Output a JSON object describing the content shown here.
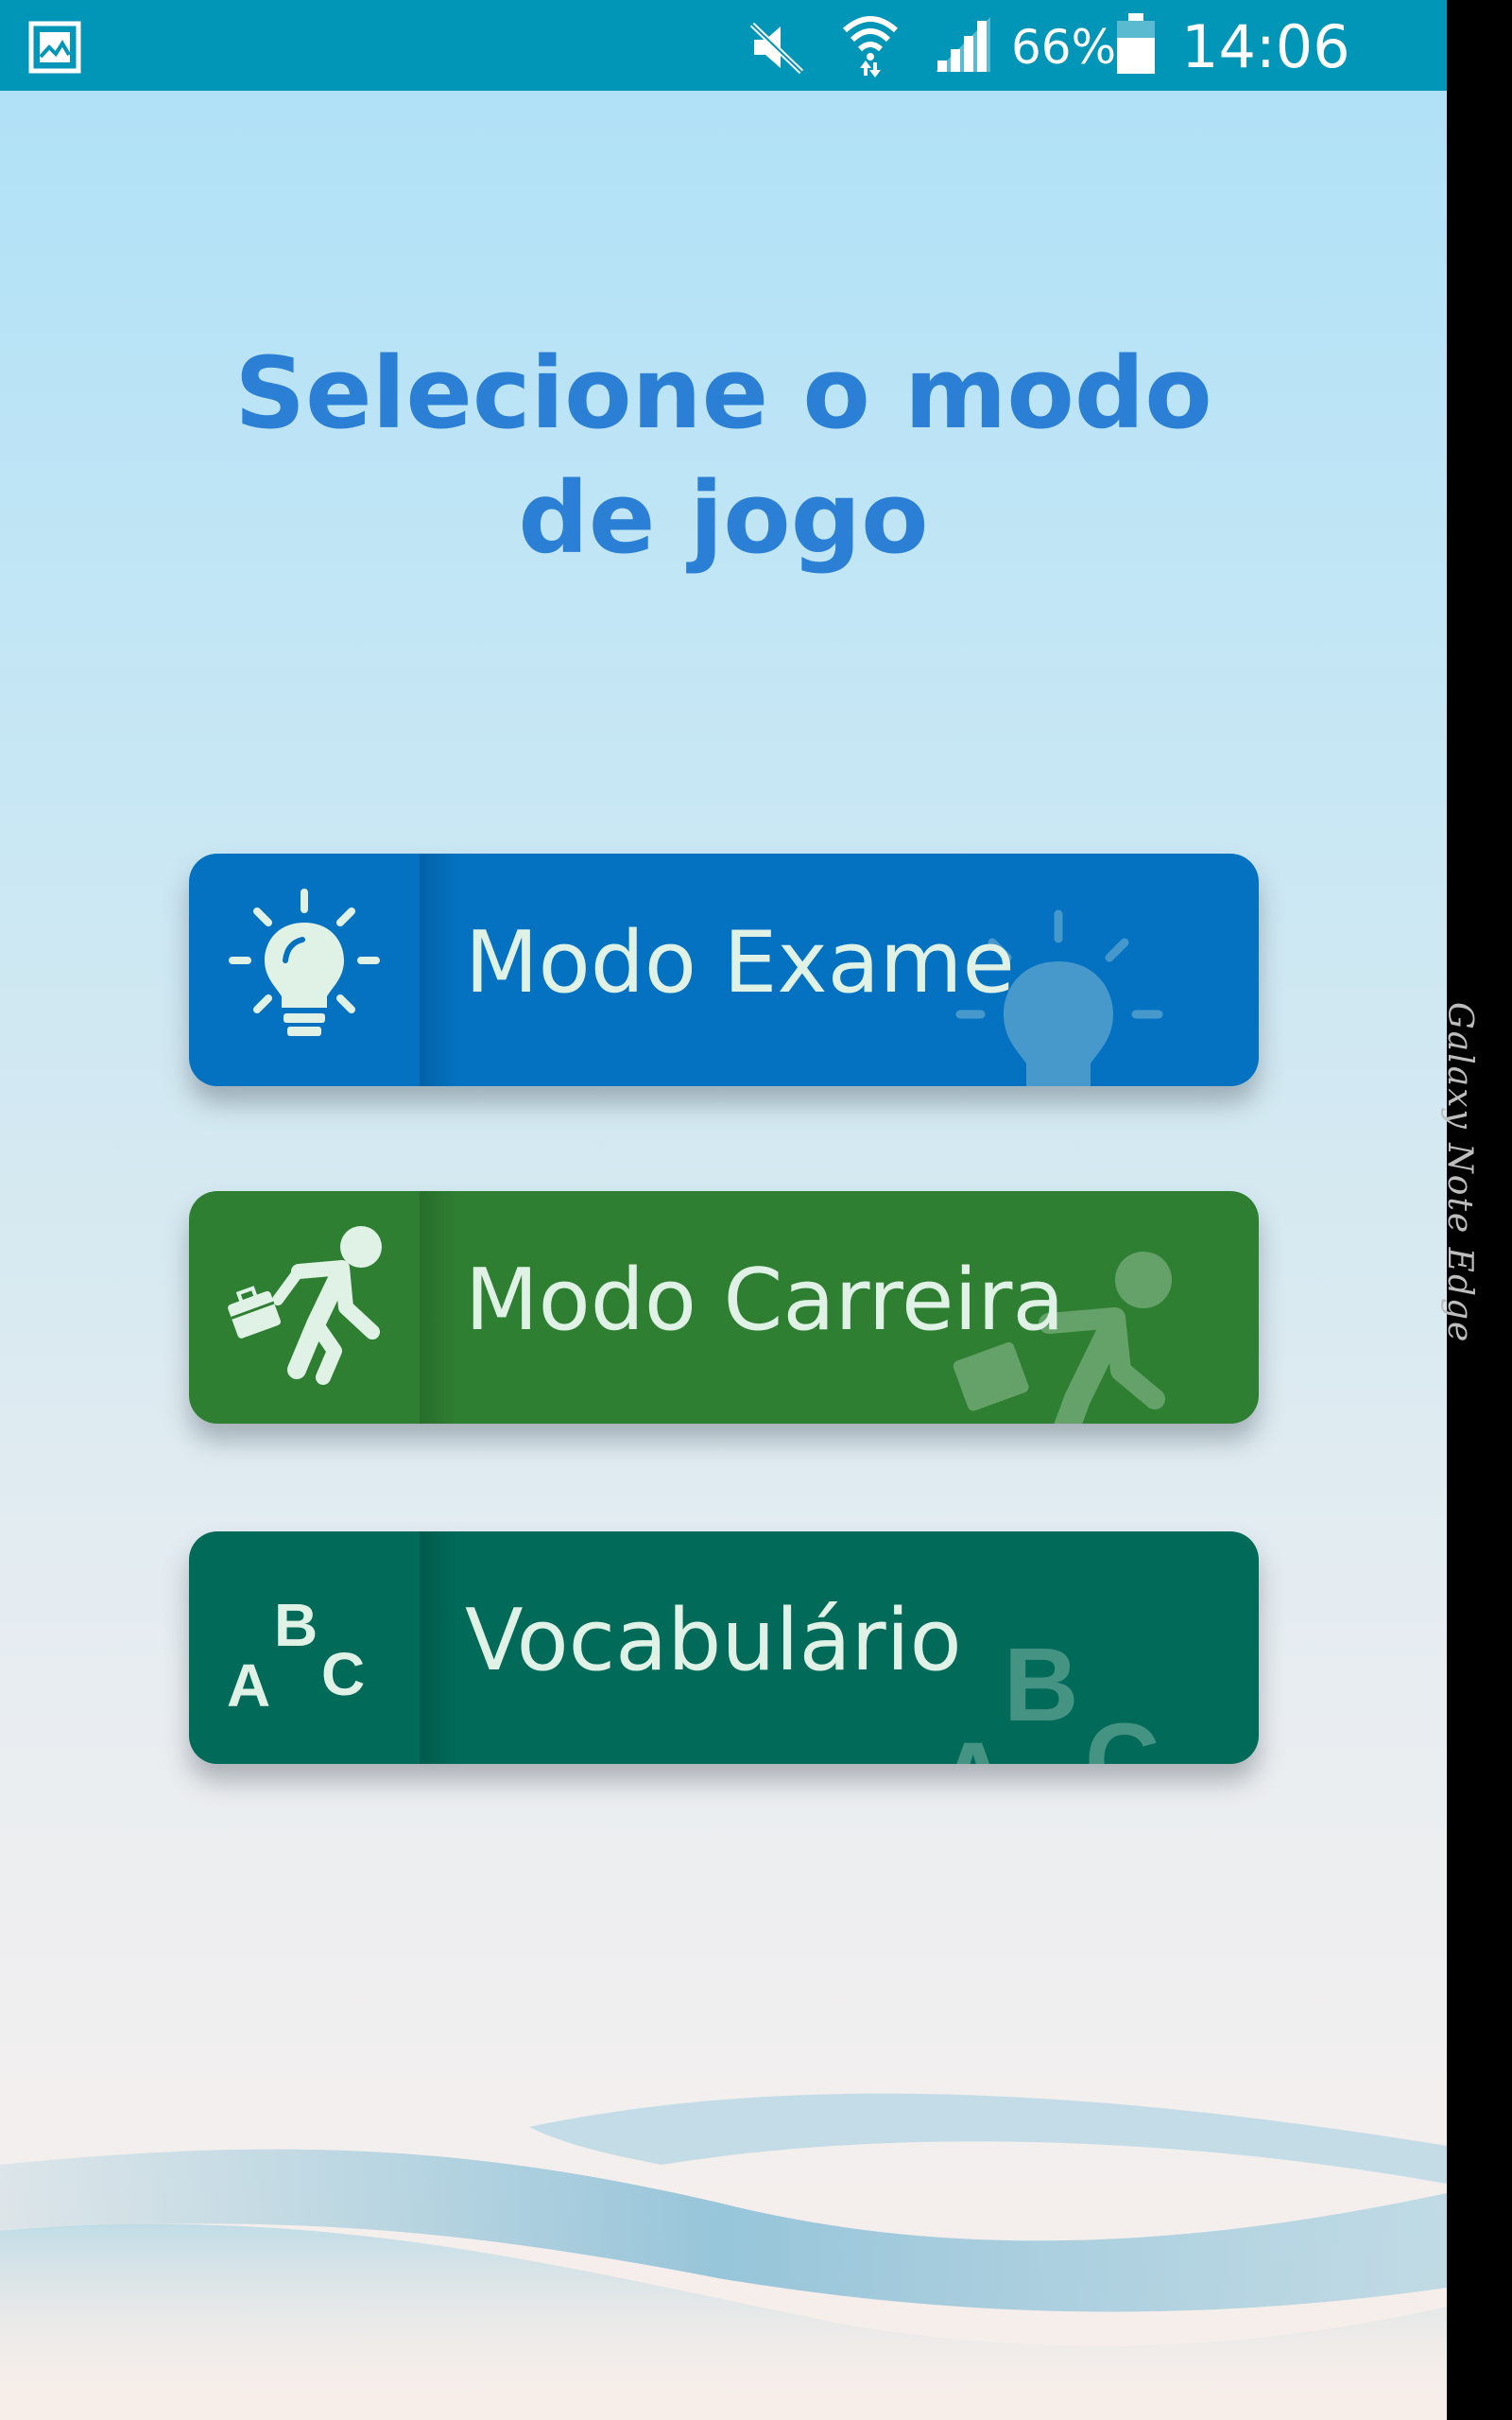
{
  "status_bar": {
    "battery_percent": "66%",
    "time": "14:06",
    "icons": [
      "gallery-icon",
      "mute-icon",
      "wifi-icon",
      "signal-icon",
      "battery-icon"
    ]
  },
  "title": "Selecione o modo de jogo",
  "modes": [
    {
      "label": "Modo Exame",
      "icon": "lightbulb-icon",
      "color": "#0472c1"
    },
    {
      "label": "Modo Carreira",
      "icon": "walking-person-briefcase-icon",
      "color": "#2f7f33"
    },
    {
      "label": "Vocabulário",
      "icon": "abc-letters-icon",
      "color": "#016a59"
    }
  ],
  "device_edge_label": "Galaxy Note Edge",
  "colors": {
    "status_bar": "#0195b7",
    "title": "#2b7fd4",
    "label_text": "#e0f2e6"
  }
}
